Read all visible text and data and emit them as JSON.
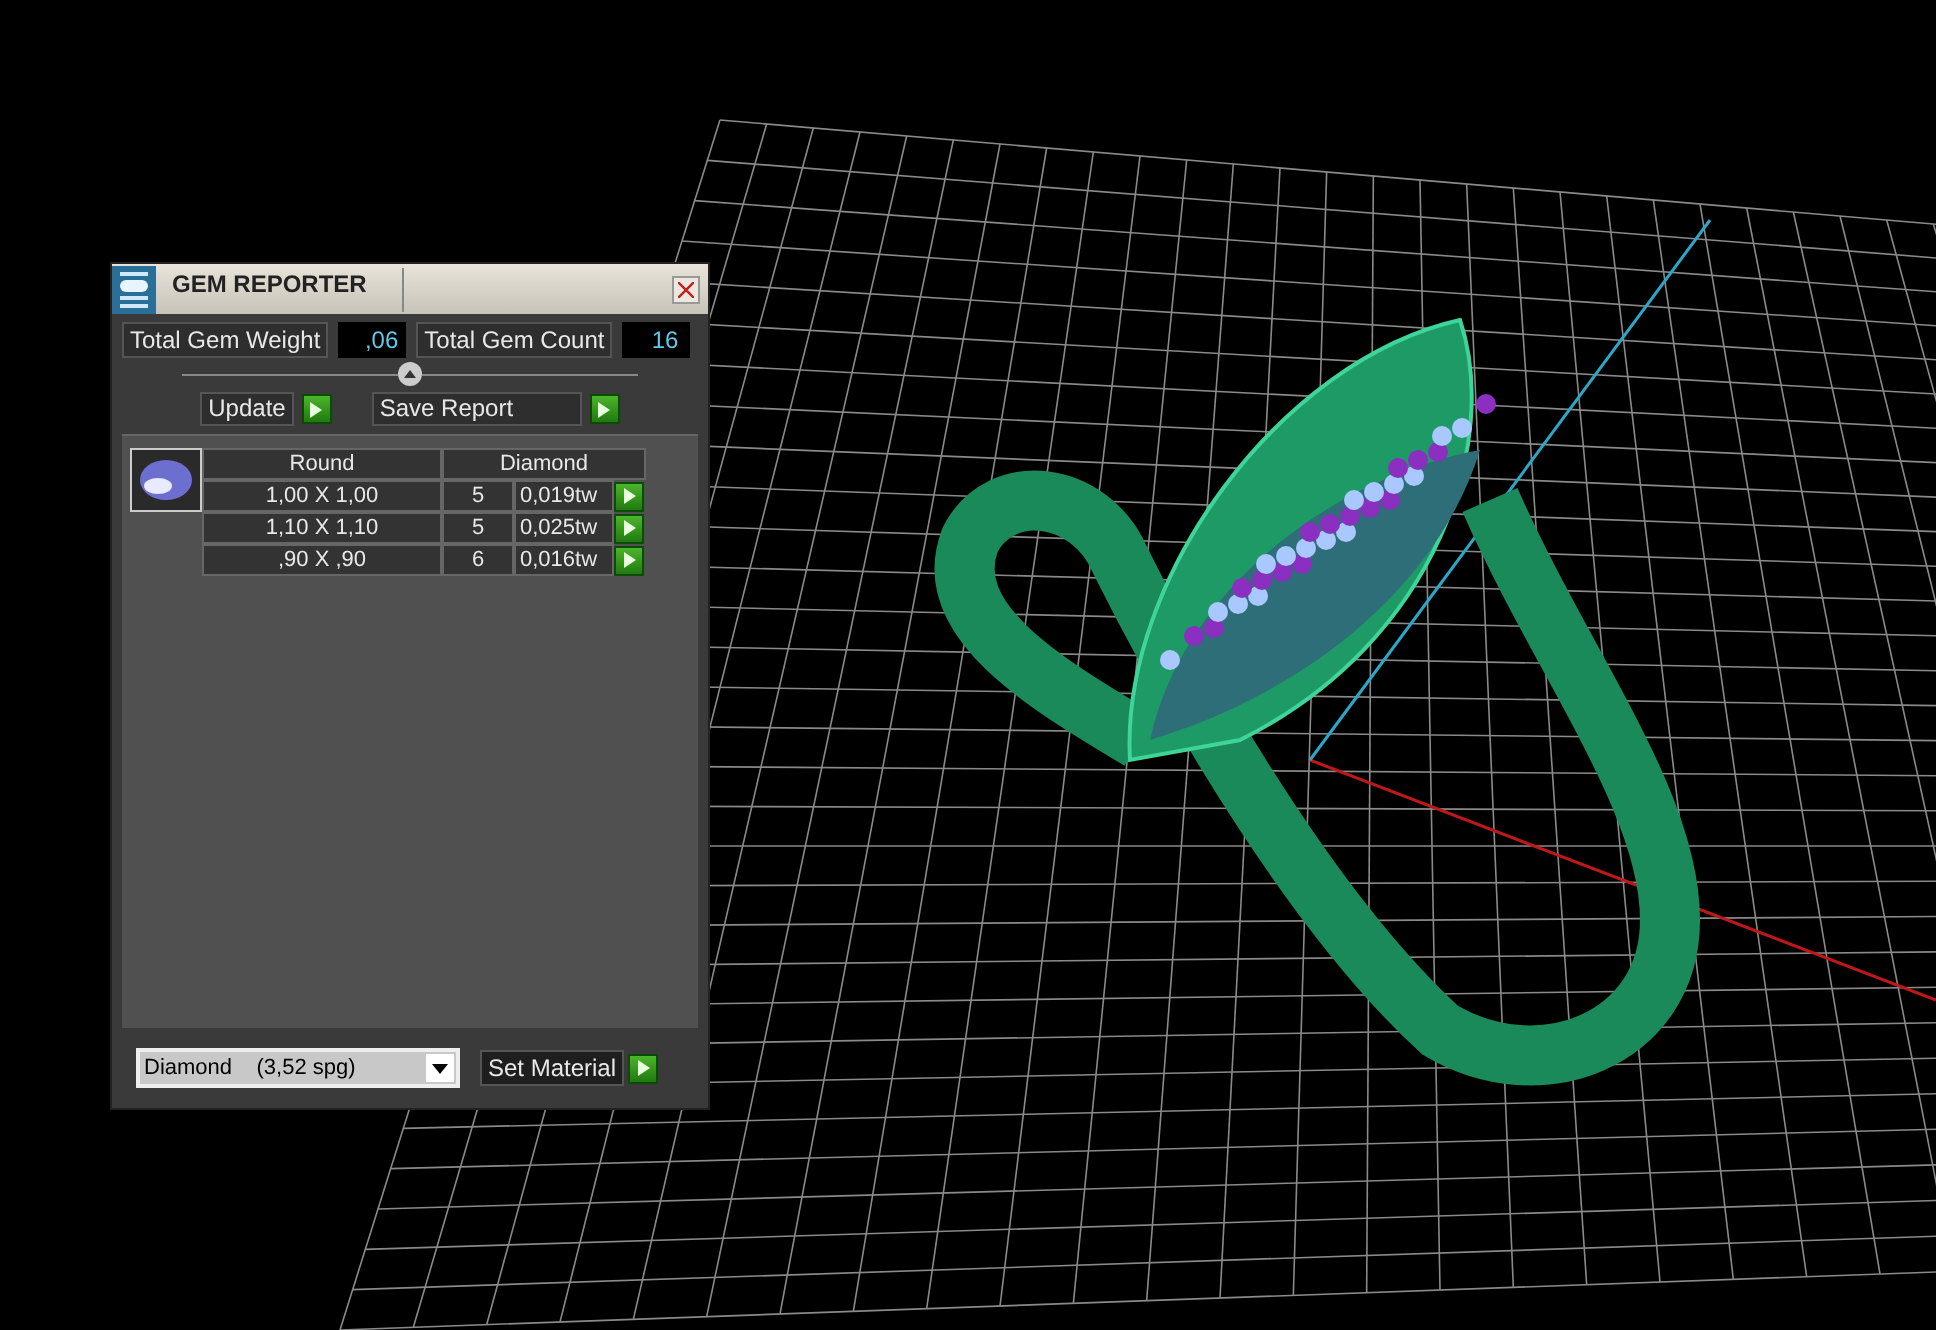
{
  "window": {
    "title": "GEM REPORTER"
  },
  "totals": {
    "weight_label": "Total Gem Weight",
    "weight": ",06",
    "count_label": "Total Gem Count",
    "count": "16"
  },
  "buttons": [
    {
      "label": "Update"
    },
    {
      "label": "Save Report"
    }
  ],
  "table": {
    "shape": "Round",
    "material": "Diamond",
    "rows": [
      {
        "size": "1,00 X 1,00",
        "count": "5",
        "weight": "0,019tw"
      },
      {
        "size": "1,10 X 1,10",
        "count": "5",
        "weight": "0,025tw"
      },
      {
        "size": ",90 X ,90",
        "count": "6",
        "weight": "0,016tw"
      }
    ]
  },
  "material_select": {
    "value": "Diamond    (3,52 spg)"
  },
  "set_button": {
    "label": "Set Material"
  }
}
